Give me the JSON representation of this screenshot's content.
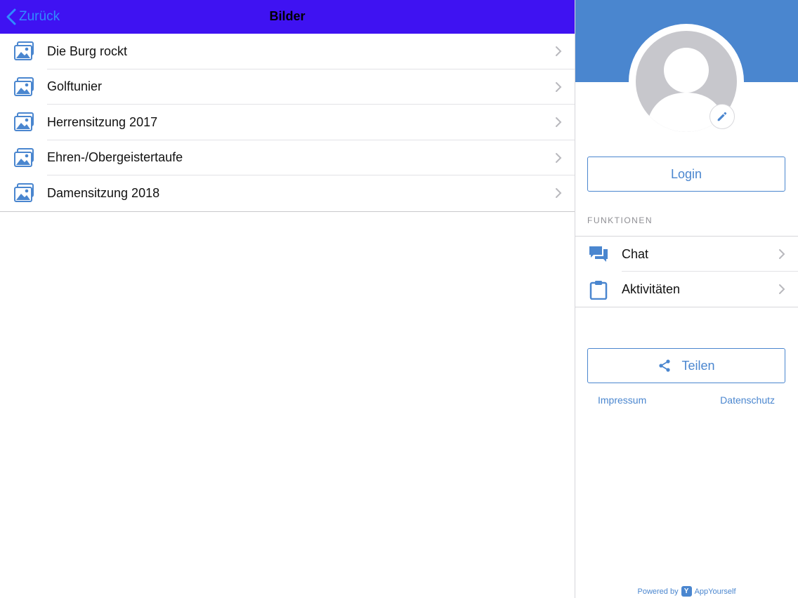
{
  "navbar": {
    "back_label": "Zurück",
    "title": "Bilder",
    "back_color": "#2f8cff",
    "background": "#3f12f2"
  },
  "albums": [
    {
      "label": "Die Burg rockt",
      "icon": "photo-album-icon"
    },
    {
      "label": "Golftunier",
      "icon": "photo-album-icon"
    },
    {
      "label": "Herrensitzung 2017",
      "icon": "photo-album-icon"
    },
    {
      "label": "Ehren-/Obergeistertaufe",
      "icon": "photo-album-icon"
    },
    {
      "label": "Damensitzung 2018",
      "icon": "photo-album-icon"
    }
  ],
  "sidebar": {
    "accent_color": "#4a86cf",
    "login_label": "Login",
    "section_title": "FUNKTIONEN",
    "menu": [
      {
        "label": "Chat",
        "icon": "chat-icon"
      },
      {
        "label": "Aktivitäten",
        "icon": "clipboard-icon"
      }
    ],
    "share_label": "Teilen",
    "impressum_label": "Impressum",
    "datenschutz_label": "Datenschutz",
    "powered_by_label": "Powered by",
    "brand_label": "AppYourself"
  }
}
